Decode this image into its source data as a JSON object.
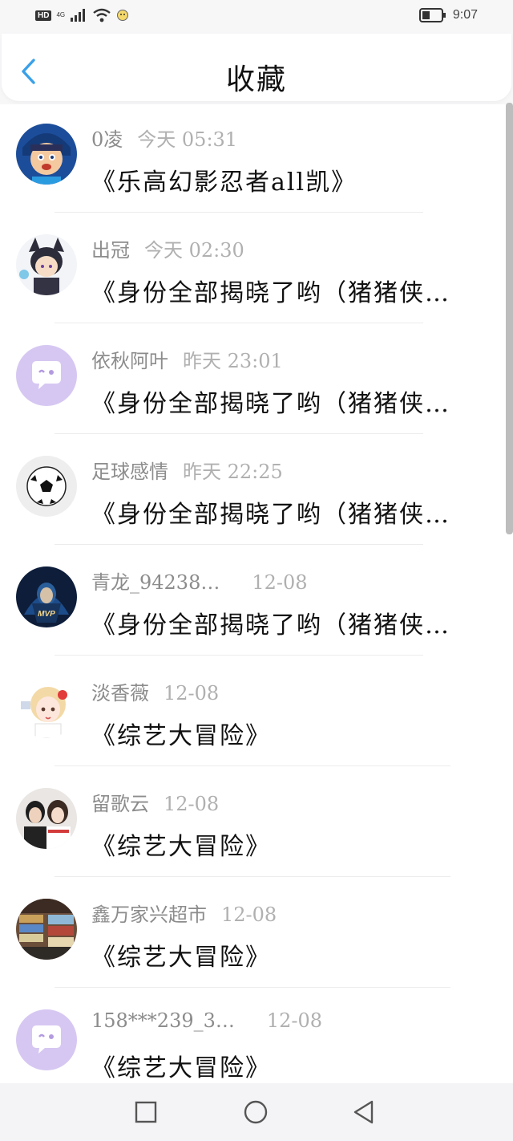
{
  "status_bar": {
    "hd": "HD",
    "network": "4G",
    "time": "9:07",
    "icons": [
      "signal-icon",
      "wifi-icon",
      "notification-icon",
      "battery-icon"
    ]
  },
  "header": {
    "title": "收藏",
    "back_icon": "chevron-left-icon",
    "accent": "#3aa0e8"
  },
  "items": [
    {
      "user": "0凌",
      "time": "今天 05:31",
      "content": "《乐高幻影忍者all凯》",
      "avatar": "cartoon-boy-avatar"
    },
    {
      "user": "出冠",
      "time": "今天 02:30",
      "content": "《身份全部揭晓了哟（猪猪侠…",
      "avatar": "anime-catboy-avatar"
    },
    {
      "user": "依秋阿叶",
      "time": "昨天 23:01",
      "content": "《身份全部揭晓了哟（猪猪侠…",
      "avatar": "chat-bubble-avatar"
    },
    {
      "user": "足球感情",
      "time": "昨天 22:25",
      "content": "《身份全部揭晓了哟（猪猪侠…",
      "avatar": "soccer-ball-avatar"
    },
    {
      "user": "青龙_94238…",
      "time": "12-08",
      "content": "《身份全部揭晓了哟（猪猪侠…",
      "avatar": "mvp-hero-avatar"
    },
    {
      "user": "淡香薇",
      "time": "12-08",
      "content": "《综艺大冒险》",
      "avatar": "anime-girl-avatar"
    },
    {
      "user": "留歌云",
      "time": "12-08",
      "content": "《综艺大冒险》",
      "avatar": "couple-photo-avatar"
    },
    {
      "user": "鑫万家兴超市",
      "time": "12-08",
      "content": "《综艺大冒险》",
      "avatar": "store-photo-avatar"
    },
    {
      "user": "158***239_3…",
      "time": "12-08",
      "content": "《综艺大冒险》",
      "avatar": "chat-bubble-avatar"
    }
  ],
  "nav": {
    "recent_icon": "square-icon",
    "home_icon": "circle-icon",
    "back_icon": "triangle-back-icon"
  }
}
